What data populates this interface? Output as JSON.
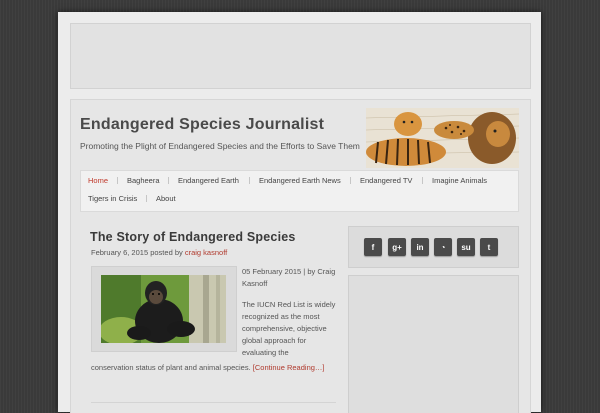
{
  "site": {
    "title": "Endangered Species Journalist",
    "tagline": "Promoting the Plight of Endangered Species and the Efforts to Save Them"
  },
  "nav": {
    "items": [
      {
        "label": "Home",
        "active": true
      },
      {
        "label": "Bagheera"
      },
      {
        "label": "Endangered Earth"
      },
      {
        "label": "Endangered Earth News"
      },
      {
        "label": "Endangered TV"
      },
      {
        "label": "Imagine Animals"
      },
      {
        "label": "Tigers in Crisis"
      },
      {
        "label": "About"
      }
    ]
  },
  "post": {
    "title": "The Story of Endangered Species",
    "date": "February 6, 2015",
    "posted_by": "posted by",
    "author": "craig kasnoff",
    "byline": "05 February 2015 | by Craig Kasnoff",
    "excerpt_side": "The IUCN Red List is widely recognized as the most comprehensive, objective global approach for evaluating the",
    "excerpt_bottom": "conservation status of plant and animal species.",
    "read_more": "[Continue Reading…]"
  },
  "social": {
    "icons": [
      {
        "name": "facebook-icon",
        "glyph": "f"
      },
      {
        "name": "google-plus-icon",
        "glyph": "g+"
      },
      {
        "name": "linkedin-icon",
        "glyph": "in"
      },
      {
        "name": "rss-icon",
        "glyph": "◔"
      },
      {
        "name": "stumbleupon-icon",
        "glyph": "su"
      },
      {
        "name": "twitter-icon",
        "glyph": "t"
      }
    ]
  },
  "colors": {
    "accent": "#c0392b",
    "background": "#3a3a3a",
    "page": "#ececec",
    "social_button": "#4a4a4a"
  }
}
